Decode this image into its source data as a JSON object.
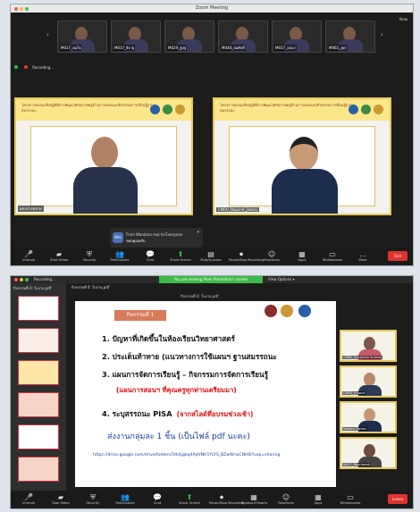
{
  "meeting1": {
    "window_title": "Zoom Meeting",
    "view_label": "View",
    "recording_label": "Recording...",
    "participants": [
      {
        "name": "M037_สมใจ"
      },
      {
        "name": "M037_จิรายุ"
      },
      {
        "name": "M029_ธูปฐ"
      },
      {
        "name": "M048_สมศักดิ์"
      },
      {
        "name": "M037_ลลนา"
      },
      {
        "name": "M065_สุดา"
      }
    ],
    "video_tiles": [
      {
        "banner": "โครงการอบรมเชิงปฏิบัติการพัฒนาศักยภาพครูด้านการออกแบบกิจกรรมการเรียนรู้ฐานสมรรถนะ",
        "name": "ผศ.ดร.สมชาย"
      },
      {
        "banner": "โครงการอบรมเชิงปฏิบัติการพัฒนาศักยภาพครูด้านการออกแบบกิจกรรมการเรียนรู้ฐานสมรรถนะ",
        "name": "CMRU_Napand_Jiwasa"
      }
    ],
    "chat_popup": {
      "sender": "From Wantana mai to Everyone",
      "message": "ขอบคุณครับ"
    },
    "toolbar": [
      {
        "icon": "mic-icon",
        "glyph": "🎤",
        "label": "Unmute"
      },
      {
        "icon": "video-icon",
        "glyph": "▰",
        "label": "Start Video"
      },
      {
        "icon": "shield-icon",
        "glyph": "⛨",
        "label": "Security"
      },
      {
        "icon": "participants-icon",
        "glyph": "👥",
        "label": "Participants"
      },
      {
        "icon": "chat-icon",
        "glyph": "💬",
        "label": "Chat"
      },
      {
        "icon": "share-screen-icon",
        "glyph": "⬆",
        "label": "Share Screen"
      },
      {
        "icon": "polls-icon",
        "glyph": "▤",
        "label": "Polls/Quizzes"
      },
      {
        "icon": "record-icon",
        "glyph": "⏺",
        "label": "Pause/Stop Recording"
      },
      {
        "icon": "reactions-icon",
        "glyph": "☺",
        "label": "Reactions"
      },
      {
        "icon": "apps-icon",
        "glyph": "▦",
        "label": "Apps"
      },
      {
        "icon": "whiteboards-icon",
        "glyph": "▭",
        "label": "Whiteboards"
      },
      {
        "icon": "more-icon",
        "glyph": "…",
        "label": "More"
      }
    ],
    "end_label": "End"
  },
  "meeting2": {
    "recording_label": "Recording...",
    "share_banner": "You are viewing Prom Promotion's screen",
    "view_options": "View Options ▾",
    "doc_title": "กิจกรรมที่ 4: ใบงาน.pdf",
    "slide": {
      "heading": "กิจกรรมที่ 1",
      "items": [
        "1.  ปัญหาที่เกิดขึ้นในห้องเรียนวิทยาศาสตร์",
        "2.  ประเด็นท้าทาย (แนวทางการใช้แผนฯ ฐานสมรรถนะ",
        "3.  แผนการจัดการเรียนรู้ – กิจกรรมการจัดการเรียนรู้",
        "4.  ระบุสรรถนะ PISA"
      ],
      "note3": "(แผนการสอนฯ ที่คุณครูทุกท่านเตรียมมา)",
      "note4": "(จากสไลด์ที่อบรมช่วงเช้า)",
      "instruction": "ส่งงานกลุ่มละ 1 ชิ้น (เป็นไฟล์ pdf นะคะ)",
      "url": "https://drive.google.com/drive/folders/1tk4jgkqdXqVNH1YLYS_BZwW-luCNH6l?usp=sharing"
    },
    "side_participants": [
      {
        "name": "CMRU_Kunjanika Kumsai"
      },
      {
        "name": "CMRU_Jirawut"
      },
      {
        "name": "Napand Jiwasa"
      },
      {
        "name": "M037_Panchanok"
      }
    ],
    "toolbar": [
      {
        "icon": "mic-icon",
        "glyph": "🎤",
        "label": "Unmute"
      },
      {
        "icon": "video-icon",
        "glyph": "▰",
        "label": "Stop Video"
      },
      {
        "icon": "shield-icon",
        "glyph": "⛨",
        "label": "Security"
      },
      {
        "icon": "participants-icon",
        "glyph": "👥",
        "label": "Participants"
      },
      {
        "icon": "chat-icon",
        "glyph": "💬",
        "label": "Chat"
      },
      {
        "icon": "share-screen-icon",
        "glyph": "⬆",
        "label": "Share Screen"
      },
      {
        "icon": "record-icon",
        "glyph": "⏺",
        "label": "Pause/Stop Recording"
      },
      {
        "icon": "breakout-icon",
        "glyph": "▦",
        "label": "Breakout Rooms"
      },
      {
        "icon": "reactions-icon",
        "glyph": "☺",
        "label": "Reactions"
      },
      {
        "icon": "apps-icon",
        "glyph": "▦",
        "label": "Apps"
      },
      {
        "icon": "whiteboards-icon",
        "glyph": "▭",
        "label": "Whiteboards"
      }
    ],
    "leave_label": "Leave"
  },
  "colors": {
    "accent_green": "#3fb94b",
    "end_red": "#e0332e",
    "banner_yellow": "#fbe68a"
  }
}
